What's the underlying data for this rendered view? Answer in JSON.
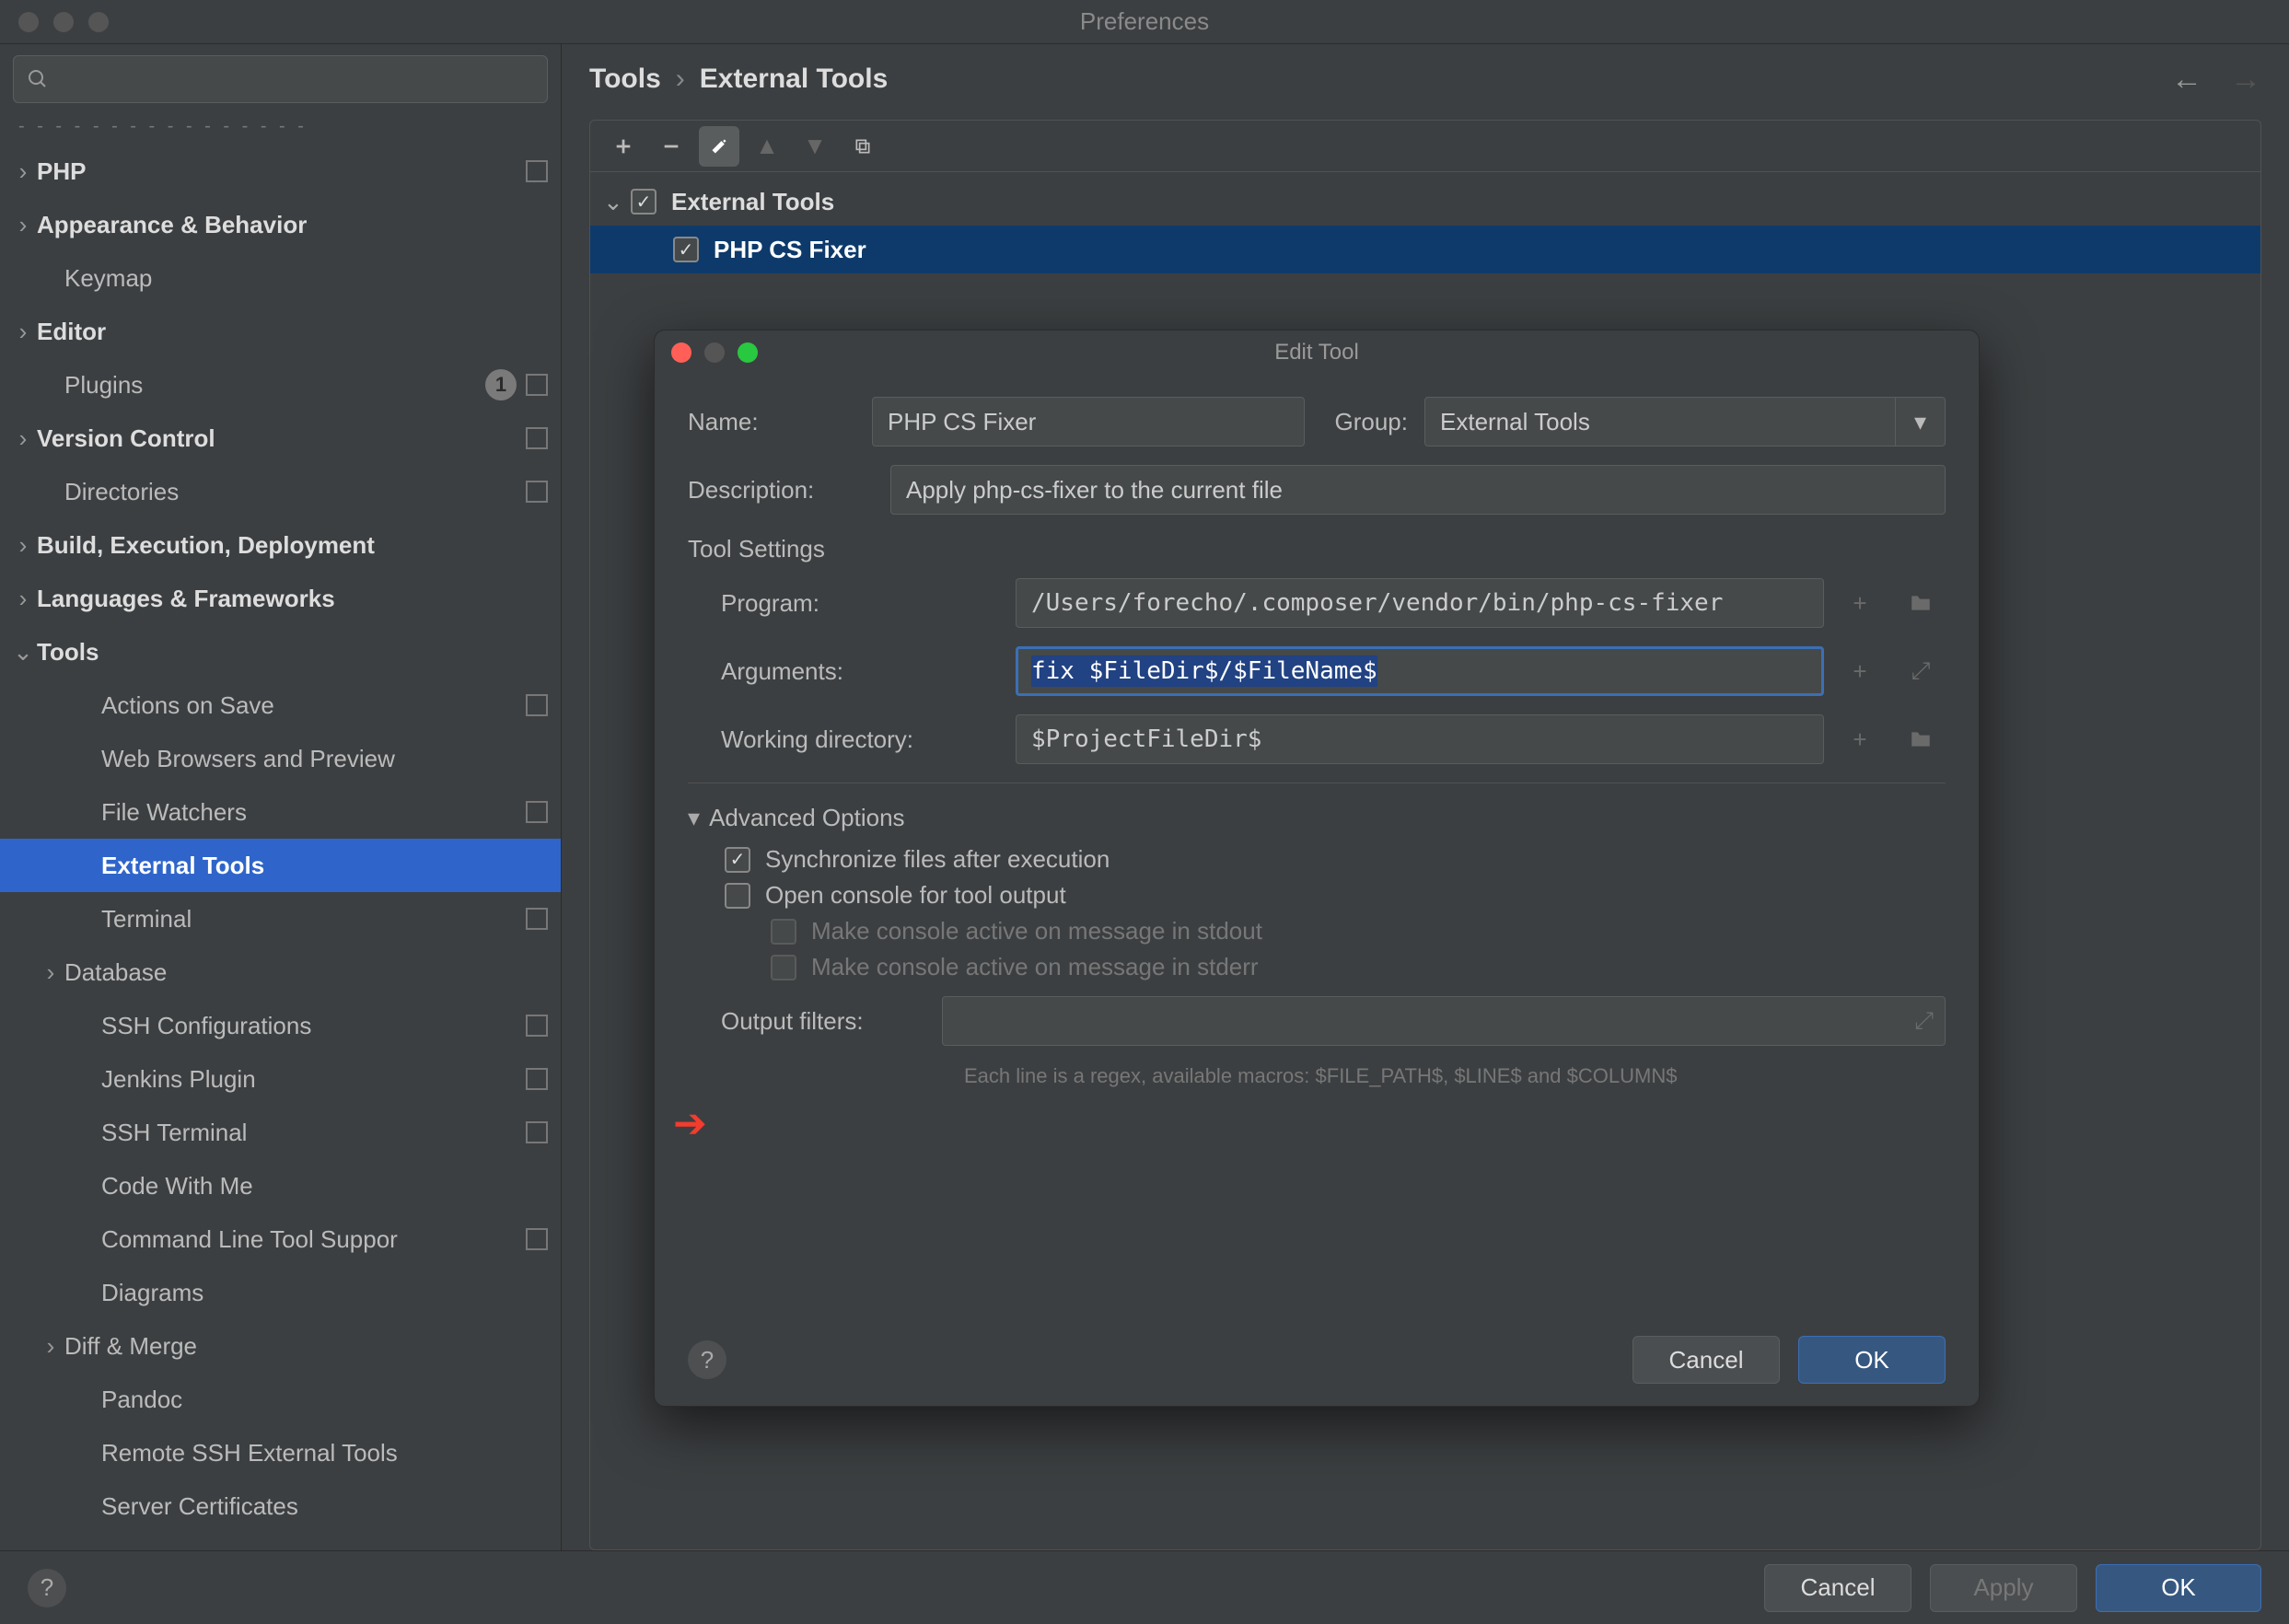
{
  "window": {
    "title": "Preferences"
  },
  "search": {
    "placeholder": ""
  },
  "breadcrumbs": {
    "root": "Tools",
    "leaf": "External Tools"
  },
  "sidebar": {
    "items": [
      {
        "label": "PHP",
        "bold": true,
        "caret": "›",
        "sq": true,
        "indent": 40
      },
      {
        "label": "Appearance & Behavior",
        "bold": true,
        "caret": "›",
        "indent": 40
      },
      {
        "label": "Keymap",
        "indent": 70
      },
      {
        "label": "Editor",
        "bold": true,
        "caret": "›",
        "indent": 40
      },
      {
        "label": "Plugins",
        "badge": "1",
        "sq": true,
        "indent": 70
      },
      {
        "label": "Version Control",
        "bold": true,
        "caret": "›",
        "sq": true,
        "indent": 40
      },
      {
        "label": "Directories",
        "sq": true,
        "indent": 70
      },
      {
        "label": "Build, Execution, Deployment",
        "bold": true,
        "caret": "›",
        "indent": 40
      },
      {
        "label": "Languages & Frameworks",
        "bold": true,
        "caret": "›",
        "indent": 40
      },
      {
        "label": "Tools",
        "bold": true,
        "caret": "⌄",
        "indent": 40
      },
      {
        "label": "Actions on Save",
        "sq": true,
        "indent": 110
      },
      {
        "label": "Web Browsers and Preview",
        "indent": 110
      },
      {
        "label": "File Watchers",
        "sq": true,
        "indent": 110
      },
      {
        "label": "External Tools",
        "selected": true,
        "indent": 110
      },
      {
        "label": "Terminal",
        "sq": true,
        "indent": 110
      },
      {
        "label": "Database",
        "caret": "›",
        "indent": 70
      },
      {
        "label": "SSH Configurations",
        "sq": true,
        "indent": 110
      },
      {
        "label": "Jenkins Plugin",
        "sq": true,
        "indent": 110
      },
      {
        "label": "SSH Terminal",
        "sq": true,
        "indent": 110
      },
      {
        "label": "Code With Me",
        "indent": 110
      },
      {
        "label": "Command Line Tool Suppor",
        "sq": true,
        "indent": 110
      },
      {
        "label": "Diagrams",
        "indent": 110
      },
      {
        "label": "Diff & Merge",
        "caret": "›",
        "indent": 70
      },
      {
        "label": "Pandoc",
        "indent": 110
      },
      {
        "label": "Remote SSH External Tools",
        "indent": 110
      },
      {
        "label": "Server Certificates",
        "indent": 110
      }
    ]
  },
  "tool_list": {
    "group_label": "External Tools",
    "item_label": "PHP CS Fixer"
  },
  "dialog": {
    "title": "Edit Tool",
    "labels": {
      "name": "Name:",
      "group": "Group:",
      "description": "Description:",
      "tool_settings": "Tool Settings",
      "program": "Program:",
      "arguments": "Arguments:",
      "working_dir": "Working directory:",
      "advanced": "Advanced Options",
      "output_filters": "Output filters:"
    },
    "values": {
      "name": "PHP CS Fixer",
      "group": "External Tools",
      "description": "Apply php-cs-fixer to the current file",
      "program": "/Users/forecho/.composer/vendor/bin/php-cs-fixer",
      "arguments": "fix $FileDir$/$FileName$",
      "working_dir": "$ProjectFileDir$",
      "output_filters": ""
    },
    "checks": {
      "sync": "Synchronize files after execution",
      "open_console": "Open console for tool output",
      "stdout": "Make console active on message in stdout",
      "stderr": "Make console active on message in stderr"
    },
    "hint": "Each line is a regex, available macros: $FILE_PATH$, $LINE$ and $COLUMN$",
    "buttons": {
      "cancel": "Cancel",
      "ok": "OK"
    }
  },
  "footer": {
    "cancel": "Cancel",
    "apply": "Apply",
    "ok": "OK"
  }
}
